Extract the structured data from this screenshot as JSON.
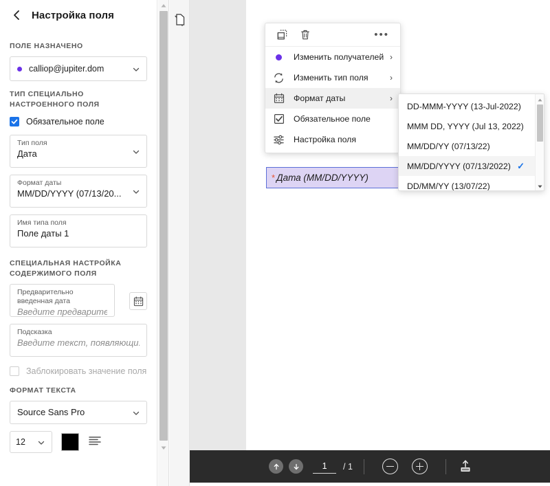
{
  "panel": {
    "title": "Настройка поля",
    "back_icon": "chevron-left-icon",
    "sections": {
      "assigned_label": "ПОЛЕ НАЗНАЧЕНО",
      "assigned_value": "calliop@jupiter.dom",
      "custom_type_label": "ТИП СПЕЦИАЛЬНО НАСТРОЕННОГО ПОЛЯ",
      "required_checkbox_label": "Обязательное поле",
      "required_checked": true,
      "content_label": "СПЕЦИАЛЬНАЯ НАСТРОЙКА СОДЕРЖИМОГО ПОЛЯ",
      "text_format_label": "ФОРМАТ ТЕКСТА"
    },
    "fields": {
      "field_type_label": "Тип поля",
      "field_type_value": "Дата",
      "date_format_label": "Формат даты",
      "date_format_value": "MM/DD/YYYY (07/13/20...",
      "type_name_label": "Имя типа поля",
      "type_name_value": "Поле даты 1",
      "prefill_label": "Предварительно введенная дата",
      "prefill_placeholder": "Введите предварительно за...",
      "tooltip_label": "Подсказка",
      "tooltip_placeholder": "Введите текст, появляющи...",
      "lock_checkbox_label": "Заблокировать значение поля",
      "lock_checked": false,
      "font_family": "Source Sans Pro",
      "font_size": "12",
      "font_color": "#000000"
    }
  },
  "context_menu": {
    "toolbar": {
      "resize_icon": "resize-field-icon",
      "delete_icon": "trash-icon",
      "more_icon": "more-options-icon",
      "more_label": "•••"
    },
    "items": [
      {
        "label": "Изменить получателей",
        "icon": "recipient-dot-icon",
        "arrow": "›"
      },
      {
        "label": "Изменить тип поля",
        "icon": "refresh-icon",
        "arrow": "›"
      },
      {
        "label": "Формат даты",
        "icon": "calendar-icon",
        "arrow": "›"
      },
      {
        "label": "Обязательное поле",
        "icon": "checkbox-checked-icon",
        "arrow": ""
      },
      {
        "label": "Настройка поля",
        "icon": "sliders-icon",
        "arrow": ""
      }
    ]
  },
  "submenu": {
    "options": [
      {
        "label": "DD-MMM-YYYY (13-Jul-2022)",
        "selected": false
      },
      {
        "label": "MMM DD, YYYY (Jul 13, 2022)",
        "selected": false
      },
      {
        "label": "MM/DD/YY (07/13/22)",
        "selected": false
      },
      {
        "label": "MM/DD/YYYY (07/13/2022)",
        "selected": true
      },
      {
        "label": "DD/MM/YY (13/07/22)",
        "selected": false
      }
    ],
    "check_glyph": "✓",
    "scroll_up_icon": "scroll-up-arrow-icon",
    "scroll_down_icon": "scroll-down-arrow-icon"
  },
  "canvas": {
    "field_required_marker": "*",
    "field_text": "Дата (MM/DD/YYYY)",
    "thumbnail_icon": "pages-thumbnail-icon"
  },
  "bottom_toolbar": {
    "prev_page_icon": "arrow-up-circle-icon",
    "next_page_icon": "arrow-down-circle-icon",
    "page_current": "1",
    "page_total": "/ 1",
    "zoom_out_icon": "zoom-out-icon",
    "zoom_in_icon": "zoom-in-icon",
    "upload_icon": "upload-signature-icon"
  },
  "colors": {
    "accent_purple": "#6b31e8",
    "checkbox_blue": "#1a73e8",
    "field_fill": "#ddd4f4",
    "field_border": "#5b6fd8",
    "required_star": "#e8522e",
    "toolbar_dark": "#2b2b2b"
  }
}
